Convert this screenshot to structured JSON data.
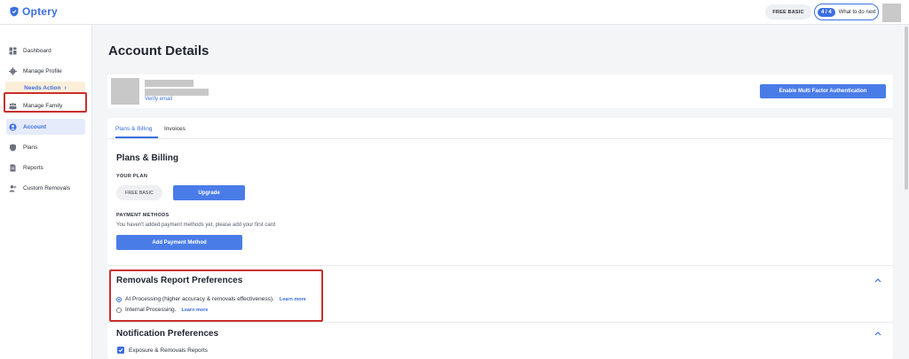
{
  "app": {
    "brand": "Optery",
    "brand_color": "#3b6fe0",
    "plan_badge": "FREE BASIC",
    "todo_count": "4 / 4",
    "todo_label": "What to do next"
  },
  "sidebar": {
    "items": [
      {
        "label": "Dashboard",
        "icon": "dashboard-icon"
      },
      {
        "label": "Manage Profile",
        "icon": "gear-icon"
      },
      {
        "label": "Manage Family",
        "icon": "family-icon"
      },
      {
        "label": "Account",
        "icon": "user-circle-icon",
        "active": true
      },
      {
        "label": "Plans",
        "icon": "shield-icon"
      },
      {
        "label": "Reports",
        "icon": "document-icon"
      },
      {
        "label": "Custom Removals",
        "icon": "user-plus-icon"
      }
    ],
    "needs_action": "Needs Action"
  },
  "main": {
    "title": "Account Details",
    "profile": {
      "verify_email": "Verify email",
      "mfa_button": "Enable Multi Factor Authentication"
    },
    "tabs": [
      {
        "label": "Plans & Billing",
        "active": true
      },
      {
        "label": "Invoices",
        "active": false
      }
    ],
    "plans_billing": {
      "title": "Plans & Billing",
      "your_plan_label": "YOUR PLAN",
      "current_plan": "FREE BASIC",
      "upgrade_button": "Upgrade",
      "payment_methods_label": "PAYMENT METHODS",
      "payment_hint": "You haven't added payment methods yet, please add your first card",
      "add_payment_button": "Add Payment Method"
    },
    "removals_prefs": {
      "title": "Removals Report Preferences",
      "options": [
        {
          "label": "AI Processing (higher accuracy & removals effectiveness).",
          "learn_more": "Learn more",
          "selected": true
        },
        {
          "label": "Internal Processing.",
          "learn_more": "Learn more",
          "selected": false
        }
      ]
    },
    "notification_prefs": {
      "title": "Notification Preferences",
      "checkbox_label": "Exposure & Removals Reports",
      "checked": true
    }
  },
  "colors": {
    "primary_button": "#4a7ce8",
    "highlight_box": "#c9302c",
    "needs_action_bg": "#fcefd9"
  }
}
